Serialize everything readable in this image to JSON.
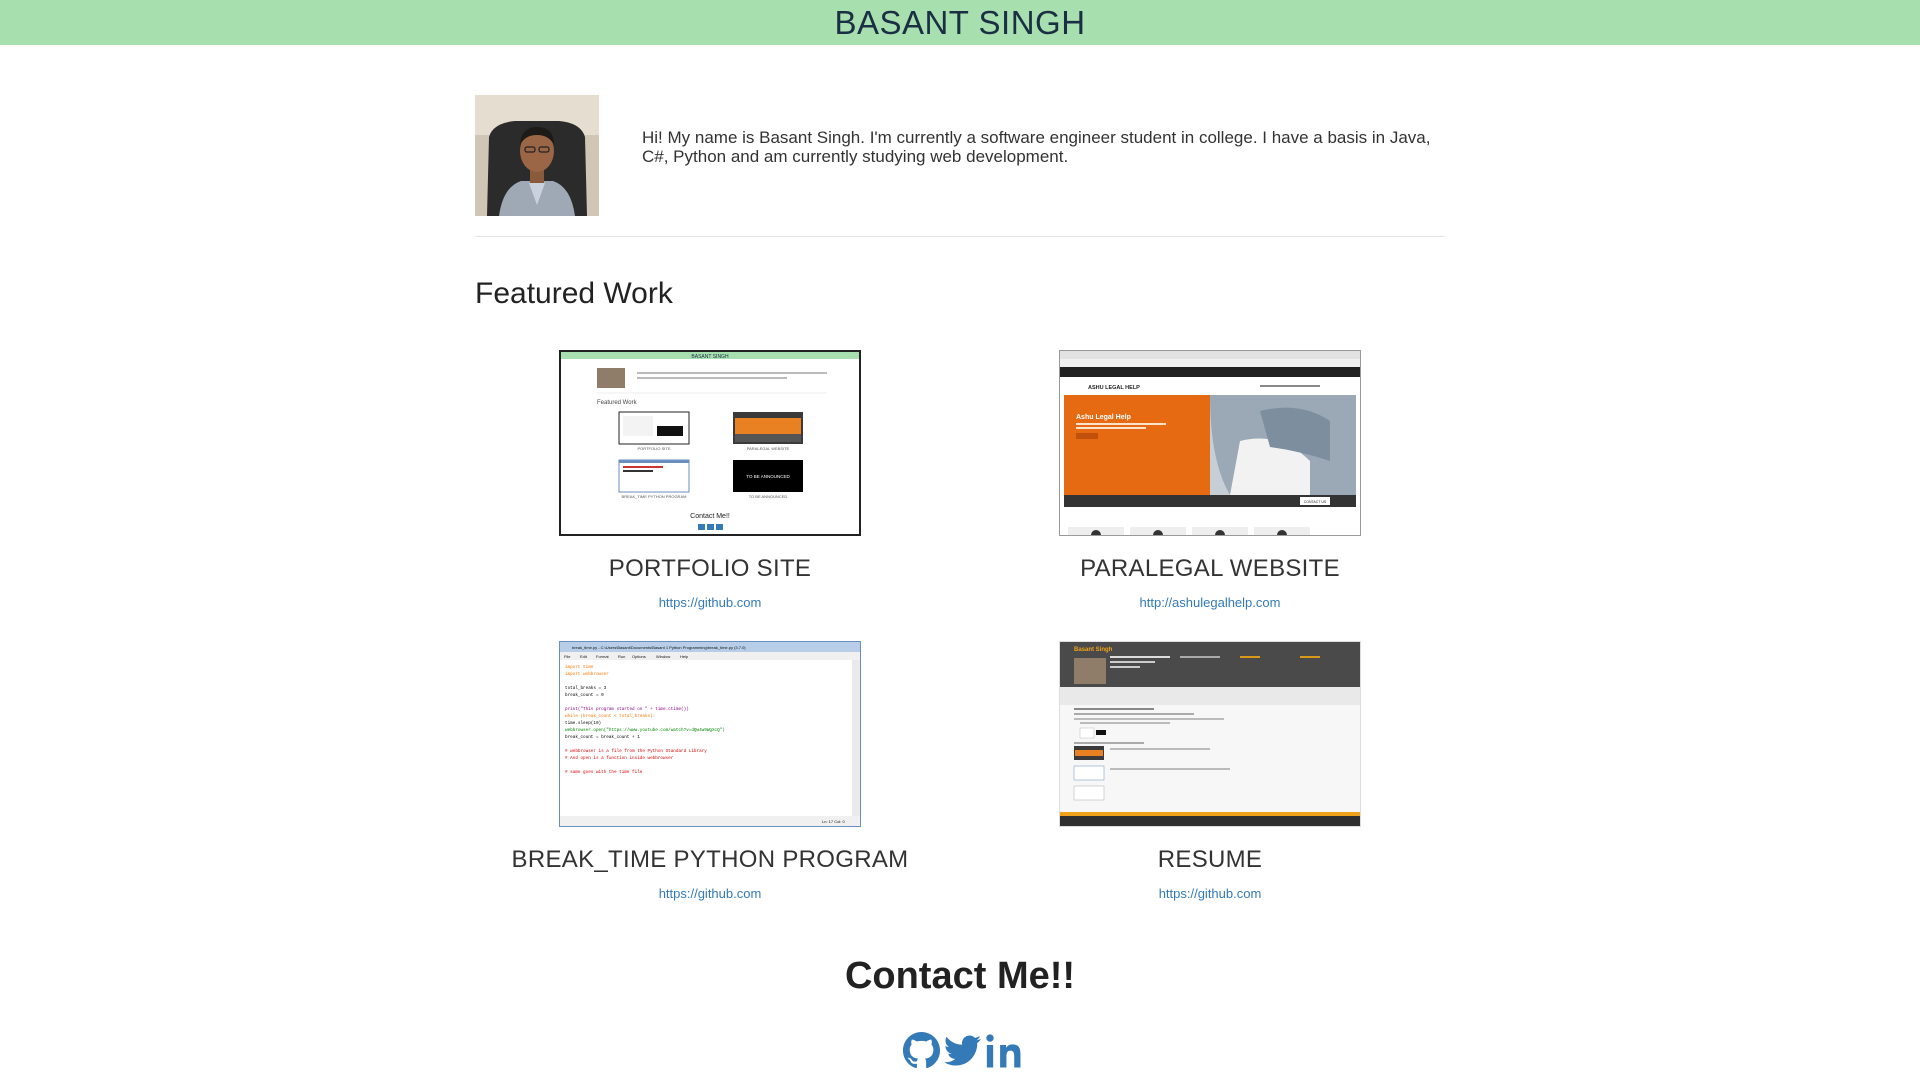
{
  "header": {
    "title": "BASANT SINGH"
  },
  "about": {
    "text": "Hi! My name is Basant Singh. I'm currently a software engineer student in college. I have a basis in Java, C#, Python and am currently studying web development."
  },
  "featured": {
    "title": "Featured Work",
    "items": [
      {
        "title": "PORTFOLIO SITE",
        "link": "https://github.com"
      },
      {
        "title": "PARALEGAL WEBSITE",
        "link": "http://ashulegalhelp.com"
      },
      {
        "title": "BREAK_TIME PYTHON PROGRAM",
        "link": "https://github.com"
      },
      {
        "title": "RESUME",
        "link": "https://github.com"
      }
    ]
  },
  "thumbs": {
    "portfolio": {
      "header": "BASANT SINGH",
      "featured": "Featured Work",
      "labels": [
        "PORTFOLIO SITE",
        "PARALEGAL WEBSITE",
        "BREAK_TIME PYTHON PROGRAM",
        "TO BE ANNOUNCED"
      ],
      "announced": "TO BE ANNOUNCED",
      "contact": "Contact Me!!"
    },
    "paralegal": {
      "brand": "ASHU LEGAL HELP",
      "hero": "Ashu Legal Help",
      "button": "CONTACT US"
    },
    "python": {
      "titlebar": "break_time.py - C:\\Users\\Basant\\Documents\\Basant 1 Python Programming\\break_time.py (3.7.0)",
      "menu": [
        "File",
        "Edit",
        "Format",
        "Run",
        "Options",
        "Window",
        "Help"
      ],
      "code": [
        "import time",
        "import webbrowser",
        "",
        "total_breaks = 3",
        "break_count = 0",
        "",
        "print(\"This program started on \" + time.ctime())",
        "while (break_count < total_breaks):",
        "    time.sleep(10)",
        "    webbrowser.open(\"https://www.youtube.com/watch?v=dQw4w9WgXcQ\")",
        "    break_count = break_count + 1",
        "",
        "# webbrowser is a file from the Python Standard Library",
        "# And open is a function inside webbrowser",
        "",
        "# same goes with the time file"
      ],
      "status": "Ln: 17  Col: 0"
    },
    "resume": {
      "name": "Basant Singh"
    }
  },
  "contact": {
    "title": "Contact Me!!"
  },
  "social_icons": [
    "github-icon",
    "twitter-icon",
    "linkedin-icon"
  ],
  "colors": {
    "header_bg": "#a8dfae",
    "link": "#337ab7",
    "social": "#337ab7"
  }
}
